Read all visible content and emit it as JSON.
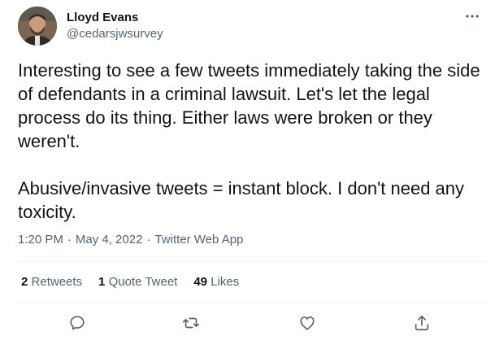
{
  "author": {
    "display_name": "Lloyd Evans",
    "handle": "@cedarsjwsurvey",
    "avatar_icon": "user-avatar"
  },
  "tweet": {
    "paragraphs": [
      "Interesting to see a few tweets immediately taking the side of defendants in a criminal lawsuit. Let's let the legal process do its thing. Either laws were broken or they weren't.",
      "Abusive/invasive tweets = instant block. I don't need any toxicity."
    ],
    "time": "1:20 PM",
    "date": "May 4, 2022",
    "source": "Twitter Web App",
    "separator": "·"
  },
  "stats": {
    "retweets_count": "2",
    "retweets_label": "Retweets",
    "quotes_count": "1",
    "quotes_label": "Quote Tweet",
    "likes_count": "49",
    "likes_label": "Likes"
  },
  "actions": {
    "icons": [
      "reply-icon",
      "retweet-icon",
      "like-icon",
      "share-icon"
    ]
  },
  "colors": {
    "text_primary": "#0f1419",
    "text_secondary": "#536471",
    "divider": "#eff3f4",
    "icon": "#536471"
  }
}
